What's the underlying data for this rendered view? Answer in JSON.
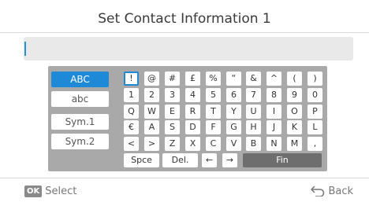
{
  "header": {
    "title": "Set Contact Information 1"
  },
  "input": {
    "value": ""
  },
  "keyboard": {
    "modes": [
      "ABC",
      "abc",
      "Sym.1",
      "Sym.2"
    ],
    "active_mode": "ABC",
    "rows": [
      [
        "!",
        "@",
        "#",
        "£",
        "%",
        "“",
        "&",
        "^",
        "(",
        ")"
      ],
      [
        "1",
        "2",
        "3",
        "4",
        "5",
        "6",
        "7",
        "8",
        "9",
        "0"
      ],
      [
        "Q",
        "W",
        "E",
        "R",
        "T",
        "Y",
        "U",
        "I",
        "O",
        "P"
      ],
      [
        "€",
        "A",
        "S",
        "D",
        "F",
        "G",
        "H",
        "J",
        "K",
        "L"
      ],
      [
        "<",
        ">",
        "Z",
        "X",
        "C",
        "V",
        "B",
        "N",
        "M",
        ","
      ]
    ],
    "selected_key": "!",
    "bottom_row": {
      "space": "Spce",
      "delete": "Del.",
      "left": "←",
      "right": "→",
      "finish": "Fin"
    }
  },
  "footer": {
    "ok_badge": "OK",
    "select": "Select",
    "back": "Back",
    "back_icon": "return-arrow-icon"
  },
  "colors": {
    "accent": "#1e8ad7",
    "keyboard_bg": "#a9a9a9",
    "fin_bg": "#6e6e6e"
  }
}
